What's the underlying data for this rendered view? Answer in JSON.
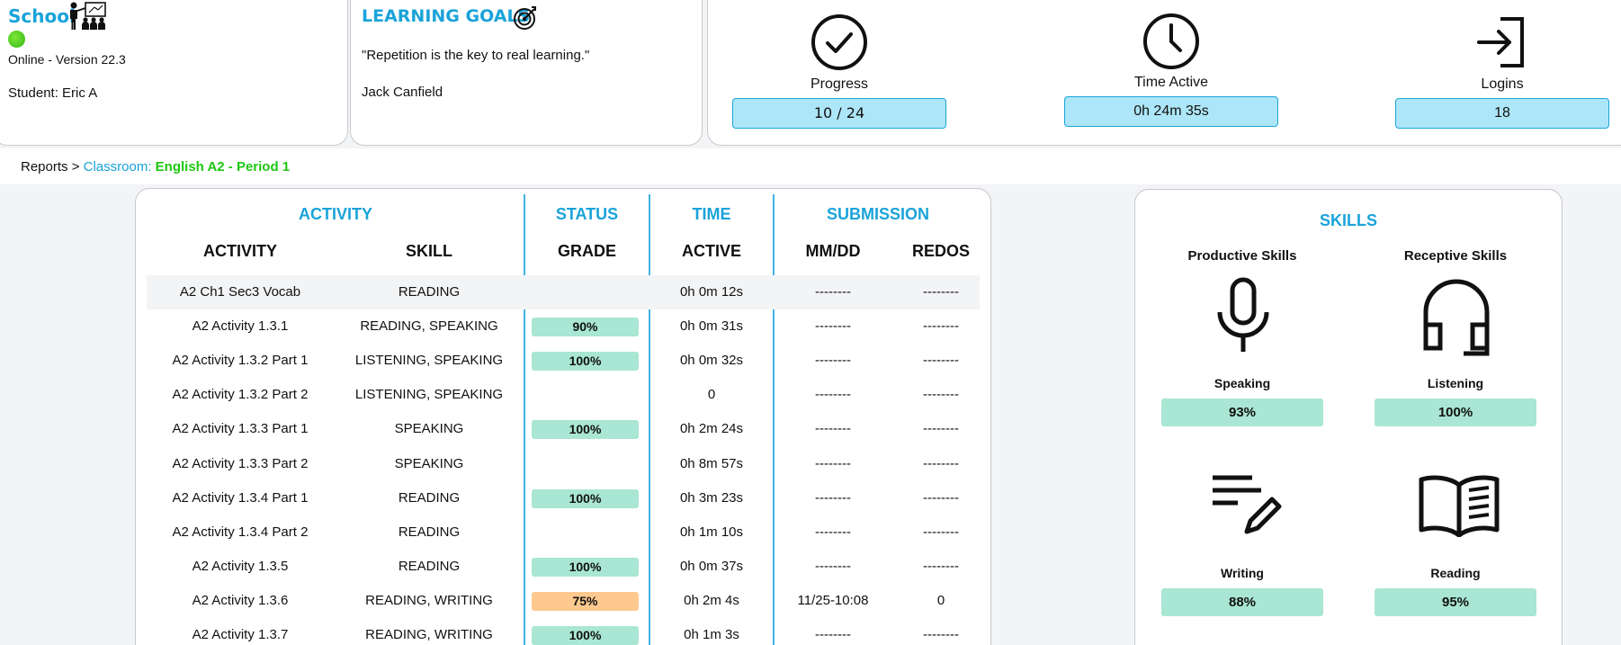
{
  "school": {
    "title": "School",
    "version": "Online - Version 22.3",
    "student": "Student: Eric A"
  },
  "goals": {
    "title": "LEARNING GOALS",
    "quote": "\"Repetition is the key to real learning.\"",
    "author": "Jack Canfield"
  },
  "stats": {
    "progress": {
      "label": "Progress",
      "value": "10 / 24",
      "icon": "check-circle-icon"
    },
    "time": {
      "label": "Time Active",
      "value": "0h 24m 35s",
      "icon": "clock-icon"
    },
    "logins": {
      "label": "Logins",
      "value": "18",
      "icon": "login-icon"
    }
  },
  "breadcrumb": {
    "reports": "Reports",
    "sep": ">",
    "classroom": "Classroom:",
    "course": "English A2 - Period 1"
  },
  "table": {
    "groups": {
      "activity": "ACTIVITY",
      "status": "STATUS",
      "time": "TIME",
      "submission": "SUBMISSION"
    },
    "columns": {
      "activity": "ACTIVITY",
      "skill": "SKILL",
      "grade": "GRADE",
      "active": "ACTIVE",
      "date": "MM/DD",
      "redos": "REDOS"
    },
    "rows": [
      {
        "activity": "A2 Ch1 Sec3 Vocab",
        "skill": "READING",
        "grade": "",
        "active": "0h 0m 12s",
        "date": "--------",
        "redos": "--------"
      },
      {
        "activity": "A2 Activity 1.3.1",
        "skill": "READING, SPEAKING",
        "grade": "90%",
        "active": "0h 0m 31s",
        "date": "--------",
        "redos": "--------"
      },
      {
        "activity": "A2 Activity 1.3.2 Part 1",
        "skill": "LISTENING, SPEAKING",
        "grade": "100%",
        "active": "0h 0m 32s",
        "date": "--------",
        "redos": "--------"
      },
      {
        "activity": "A2 Activity 1.3.2 Part 2",
        "skill": "LISTENING, SPEAKING",
        "grade": "",
        "active": "0",
        "date": "--------",
        "redos": "--------"
      },
      {
        "activity": "A2 Activity 1.3.3 Part 1",
        "skill": "SPEAKING",
        "grade": "100%",
        "active": "0h 2m 24s",
        "date": "--------",
        "redos": "--------"
      },
      {
        "activity": "A2 Activity 1.3.3 Part 2",
        "skill": "SPEAKING",
        "grade": "",
        "active": "0h 8m 57s",
        "date": "--------",
        "redos": "--------"
      },
      {
        "activity": "A2 Activity 1.3.4 Part 1",
        "skill": "READING",
        "grade": "100%",
        "active": "0h 3m 23s",
        "date": "--------",
        "redos": "--------"
      },
      {
        "activity": "A2 Activity 1.3.4 Part 2",
        "skill": "READING",
        "grade": "",
        "active": "0h 1m 10s",
        "date": "--------",
        "redos": "--------"
      },
      {
        "activity": "A2 Activity 1.3.5",
        "skill": "READING",
        "grade": "100%",
        "active": "0h 0m 37s",
        "date": "--------",
        "redos": "--------"
      },
      {
        "activity": "A2 Activity 1.3.6",
        "skill": "READING, WRITING",
        "grade": "75%",
        "grade_status": "warn",
        "active": "0h 2m 4s",
        "date": "11/25-10:08",
        "redos": "0"
      },
      {
        "activity": "A2 Activity 1.3.7",
        "skill": "READING, WRITING",
        "grade": "100%",
        "active": "0h 1m 3s",
        "date": "--------",
        "redos": "--------"
      }
    ]
  },
  "skills": {
    "title": "SKILLS",
    "productive": "Productive Skills",
    "receptive": "Receptive Skills",
    "speaking": {
      "name": "Speaking",
      "value": "93%",
      "icon": "microphone-icon"
    },
    "listening": {
      "name": "Listening",
      "value": "100%",
      "icon": "headphones-icon"
    },
    "writing": {
      "name": "Writing",
      "value": "88%",
      "icon": "writing-pen-icon"
    },
    "reading": {
      "name": "Reading",
      "value": "95%",
      "icon": "open-book-icon"
    }
  },
  "colors": {
    "accent": "#1aa3d9",
    "course": "#1ec711",
    "grade_good": "#a9e6d3",
    "grade_warn": "#fec98f",
    "stat_box": "#ade6f8"
  }
}
